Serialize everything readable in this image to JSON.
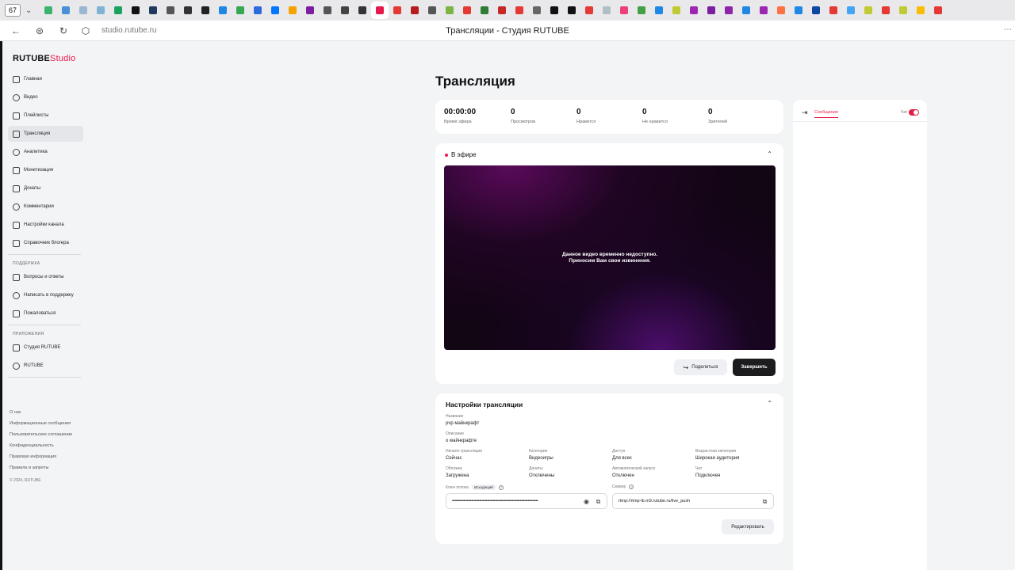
{
  "browser": {
    "tab_count": "67",
    "tab_favicon_colors": [
      "#3cb371",
      "#4a90d9",
      "#9bb7d4",
      "#7fb3d5",
      "#1aa260",
      "#111111",
      "#1f3a5f",
      "#555555",
      "#333333",
      "#222222",
      "#1e88e5",
      "#34a853",
      "#2d6cdf",
      "#0077ff",
      "#f4a300",
      "#7b1fa2",
      "#555555",
      "#444444",
      "#333333",
      "#e8194a",
      "#e53935",
      "#b71c1c",
      "#555555",
      "#7cb342",
      "#e53935",
      "#2e7d32",
      "#c62828",
      "#e53935",
      "#666666",
      "#111111",
      "#111111",
      "#e53935",
      "#b0bec5",
      "#ec407a",
      "#43a047",
      "#1e88e5",
      "#c0ca33",
      "#9c27b0",
      "#7b1fa2",
      "#8e24aa",
      "#1e88e5",
      "#9c27b0",
      "#ff7043",
      "#1e88e5",
      "#0d47a1",
      "#e53935",
      "#42a5f5",
      "#c0ca33",
      "#e53935",
      "#c0ca33",
      "#fbbc05",
      "#e53935"
    ],
    "active_tab_index": 19,
    "url": "studio.rutube.ru",
    "document_title": "Трансляции - Студия RUTUBE"
  },
  "sidebar": {
    "logo_main": "RUTUBE",
    "logo_sub": "Studio",
    "nav": [
      {
        "label": "Главная",
        "icon": "home-icon"
      },
      {
        "label": "Видео",
        "icon": "video-icon"
      },
      {
        "label": "Плейлисты",
        "icon": "playlist-icon"
      },
      {
        "label": "Трансляция",
        "icon": "broadcast-icon",
        "active": true
      },
      {
        "label": "Аналитика",
        "icon": "analytics-icon"
      },
      {
        "label": "Монетизация",
        "icon": "monetization-icon"
      },
      {
        "label": "Донаты",
        "icon": "donate-icon"
      },
      {
        "label": "Комментарии",
        "icon": "comments-icon"
      },
      {
        "label": "Настройки канала",
        "icon": "gear-icon"
      },
      {
        "label": "Справочник блогера",
        "icon": "help-icon"
      }
    ],
    "support_title": "ПОДДЕРЖКА",
    "support": [
      {
        "label": "Вопросы и ответы",
        "icon": "question-icon"
      },
      {
        "label": "Написать в поддержку",
        "icon": "mail-icon"
      },
      {
        "label": "Пожаловаться",
        "icon": "flag-icon"
      }
    ],
    "apps_title": "ПРИЛОЖЕНИЯ",
    "apps": [
      {
        "label": "Студия RUTUBE",
        "icon": "studio-app-icon"
      },
      {
        "label": "RUTUBE",
        "icon": "rutube-app-icon"
      }
    ],
    "footer": [
      "О нас",
      "Информационные сообщения",
      "Пользовательское соглашение",
      "Конфиденциальность",
      "Правовая информация",
      "Правила и запреты"
    ],
    "copyright": "© 2024, RUTUBE"
  },
  "main": {
    "title": "Трансляция",
    "stats": [
      {
        "value": "00:00:00",
        "label": "Время эфира"
      },
      {
        "value": "0",
        "label": "Просмотров"
      },
      {
        "value": "0",
        "label": "Нравится"
      },
      {
        "value": "0",
        "label": "Не нравится"
      },
      {
        "value": "0",
        "label": "Зрителей"
      }
    ],
    "live": {
      "status": "В эфире",
      "player_message_line1": "Данное видео временно недоступно.",
      "player_message_line2": "Приносим Вам свои извинения.",
      "share_label": "Поделиться",
      "finish_label": "Завершить"
    },
    "settings": {
      "title": "Настройки трансляции",
      "name_label": "Название",
      "name_value": "pvp майнкрафт",
      "desc_label": "Описание",
      "desc_value": "о майнкрафте",
      "fields": [
        {
          "label": "Начало трансляции",
          "value": "Сейчас"
        },
        {
          "label": "Категория",
          "value": "Видеоигры"
        },
        {
          "label": "Доступ",
          "value": "Для всех"
        },
        {
          "label": "Возрастная категория",
          "value": "Широкая аудитория"
        },
        {
          "label": "Обложка",
          "value": "Загружена"
        },
        {
          "label": "Донаты",
          "value": "Отключены"
        },
        {
          "label": "Автоматический запуск",
          "value": "Отключен"
        },
        {
          "label": "Чат",
          "value": "Подключен"
        }
      ],
      "key_label": "Ключ потока",
      "key_badge": "Исходящий",
      "key_value": "••••••••••••••••••••••••••••••••••••••••••••••••••••••••••••••••••••••••••••",
      "server_label": "Сервер",
      "server_value": "rtmp://rtmp-lb.m9.rutube.ru/live_push",
      "edit_label": "Редактировать"
    }
  },
  "chat": {
    "tab_label": "Сообщения",
    "toggle_label": "Чат",
    "toggle_on": true
  },
  "colors": {
    "accent": "#e8194a",
    "background": "#f3f4f6"
  }
}
